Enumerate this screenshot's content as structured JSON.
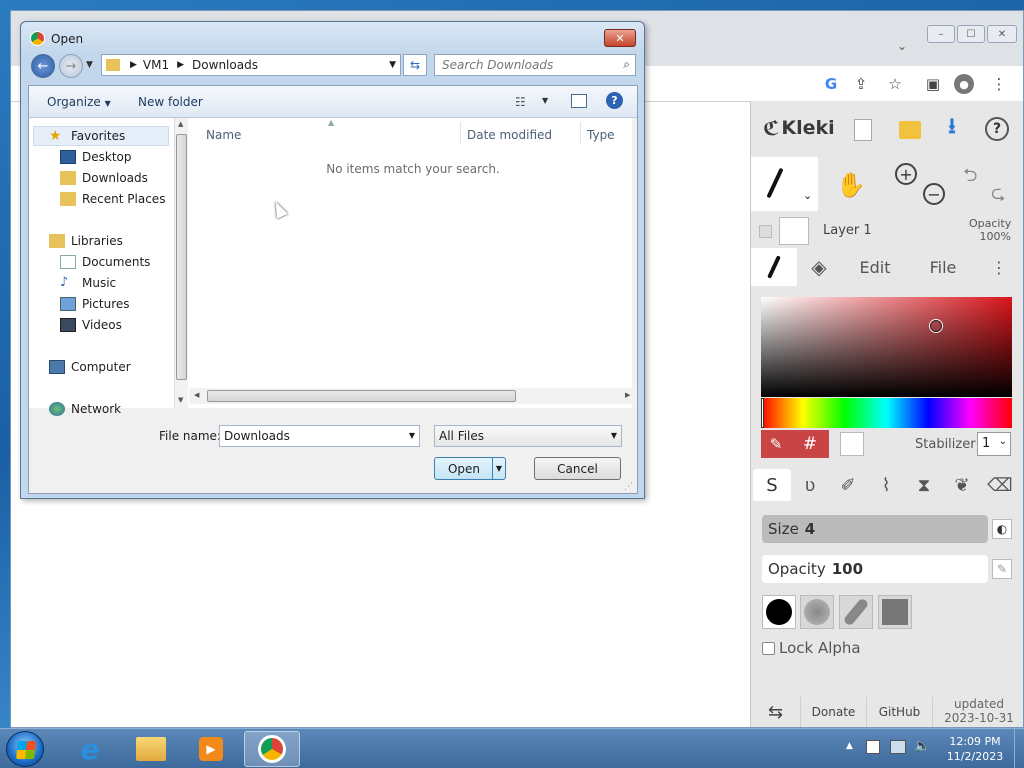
{
  "browser": {
    "window_controls": {
      "minimize": "–",
      "maximize": "☐",
      "close": "✕"
    },
    "toolbar_icons": [
      "google-icon",
      "share-icon",
      "star-icon",
      "sidepanel-icon",
      "profile-icon",
      "menu-icon"
    ]
  },
  "kleki": {
    "logo": "Kleki",
    "layer": {
      "name": "Layer 1",
      "opacity_label": "Opacity",
      "opacity_value": "100%"
    },
    "tabs": {
      "edit": "Edit",
      "file": "File"
    },
    "hash": "#",
    "stabilizer": {
      "label": "Stabilizer",
      "value": "1"
    },
    "size": {
      "label": "Size",
      "value": "4"
    },
    "opacity": {
      "label": "Opacity",
      "value": "100"
    },
    "lock_alpha": "Lock Alpha",
    "footer": {
      "donate": "Donate",
      "github": "GitHub",
      "updated_label": "updated",
      "updated_date": "2023-10-31"
    },
    "colors": {
      "accent": "#2b7ad6",
      "selected_hue": "#d9151b"
    }
  },
  "dialog": {
    "title": "Open",
    "breadcrumb": [
      "VM1",
      "Downloads"
    ],
    "search_placeholder": "Search Downloads",
    "organize": "Organize",
    "new_folder": "New folder",
    "nav": {
      "favorites": "Favorites",
      "desktop": "Desktop",
      "downloads": "Downloads",
      "recent_places": "Recent Places",
      "libraries": "Libraries",
      "documents": "Documents",
      "music": "Music",
      "pictures": "Pictures",
      "videos": "Videos",
      "computer": "Computer",
      "network": "Network"
    },
    "columns": {
      "name": "Name",
      "date_modified": "Date modified",
      "type": "Type"
    },
    "empty_message": "No items match your search.",
    "file_name_label": "File name:",
    "file_name_value": "Downloads",
    "file_type": "All Files",
    "open_button": "Open",
    "cancel_button": "Cancel"
  },
  "taskbar": {
    "time": "12:09 PM",
    "date": "11/2/2023"
  }
}
